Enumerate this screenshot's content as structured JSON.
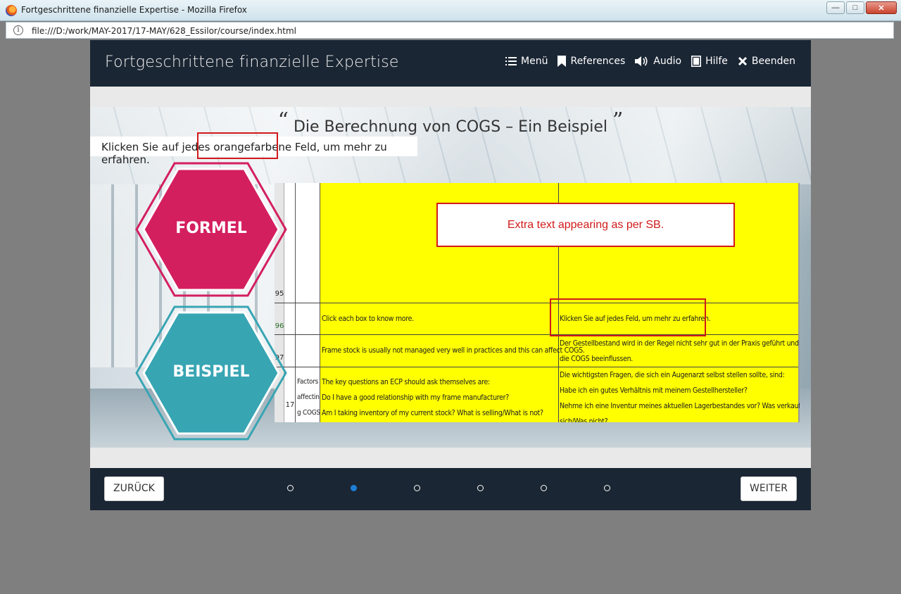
{
  "window": {
    "title": "Fortgeschrittene finanzielle Expertise - Mozilla Firefox",
    "url": "file:///D:/work/MAY-2017/17-MAY/628_Essilor/course/index.html"
  },
  "header": {
    "title": "Fortgeschrittene finanzielle Expertise",
    "nav": [
      {
        "label": "Menü",
        "icon": "list-icon"
      },
      {
        "label": "References",
        "icon": "bookmark-icon"
      },
      {
        "label": "Audio",
        "icon": "speaker-icon"
      },
      {
        "label": "Hilfe",
        "icon": "help-book-icon"
      },
      {
        "label": "Beenden",
        "icon": "close-x-icon"
      }
    ]
  },
  "slide": {
    "title": "Die Berechnung von COGS – Ein Beispiel",
    "quote_open": "“",
    "quote_close": "”",
    "instruction": "Klicken Sie auf jedes orangefarbene Feld, um mehr zu erfahren.",
    "hex_formel": "FORMEL",
    "hex_beispiel": "BEISPIEL",
    "hex_colors": {
      "formel": "#d41f5f",
      "beispiel": "#38a5b3"
    }
  },
  "sheet": {
    "extra_note": "Extra text appearing as per SB.",
    "row_95": "95",
    "row_96": "96",
    "row_97": "97",
    "row_17": "17",
    "factors": [
      "Factors",
      "affectin",
      "g COGS"
    ],
    "r96_en": "Click each box to know more.",
    "r96_de": "Klicken Sie auf jedes Feld, um mehr zu erfahren.",
    "r97_en": "Frame stock is usually not managed very well in practices and this can affect COGS.",
    "r97_de_1": "Der Gestellbestand wird in der Regel nicht sehr gut in der Praxis geführt und dies kann",
    "r97_de_2": "die COGS beeinflussen.",
    "r17_en_1": "The key questions an ECP should ask themselves are:",
    "r17_en_2": "Do I have a good relationship with my frame manufacturer?",
    "r17_en_3": "Am I taking inventory of my current stock? What is selling/What is not?",
    "r17_de_1": "Die wichtigsten Fragen, die sich ein Augenarzt selbst stellen sollte, sind:",
    "r17_de_2": "Habe ich ein gutes Verhältnis mit meinem Gestellhersteller?",
    "r17_de_3": "Nehme ich eine Inventur meines aktuellen Lagerbestandes vor? Was verkauft",
    "r17_de_4": "sich/Was nicht?"
  },
  "footer": {
    "back_label": "ZURÜCK",
    "next_label": "WEITER",
    "pages": 6,
    "current_page": 2
  }
}
